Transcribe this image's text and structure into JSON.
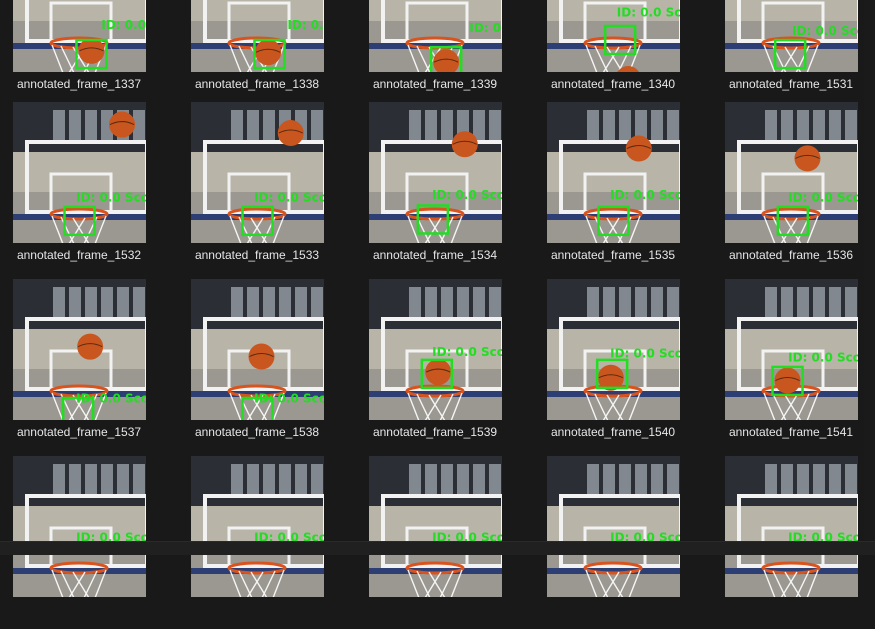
{
  "files": [
    {
      "name": "annotated_frame_1337",
      "ball": [
        0.59,
        0.85
      ],
      "det": [
        0.59,
        0.88
      ],
      "label": [
        0.74,
        0.64
      ],
      "rim": true
    },
    {
      "name": "annotated_frame_1338",
      "ball": [
        0.58,
        0.86
      ],
      "det": [
        0.59,
        0.88
      ],
      "label": [
        0.8,
        0.64
      ],
      "rim": true
    },
    {
      "name": "annotated_frame_1339",
      "ball": [
        0.58,
        0.93
      ],
      "det": [
        0.58,
        0.93
      ],
      "label": [
        0.83,
        0.66
      ],
      "rim": true
    },
    {
      "name": "annotated_frame_1340",
      "ball": [
        0.61,
        1.05
      ],
      "det": [
        0.55,
        0.78
      ],
      "label": [
        0.6,
        0.55
      ],
      "rim": true
    },
    {
      "name": "annotated_frame_1531",
      "ball": null,
      "det": [
        0.49,
        0.88
      ],
      "label": [
        0.58,
        0.68
      ],
      "rim": true
    },
    {
      "name": "annotated_frame_1532",
      "ball": [
        0.82,
        0.16
      ],
      "det": [
        0.5,
        0.85
      ],
      "label": [
        0.55,
        0.65
      ],
      "rim": true
    },
    {
      "name": "annotated_frame_1533",
      "ball": [
        0.75,
        0.22
      ],
      "det": [
        0.5,
        0.85
      ],
      "label": [
        0.55,
        0.65
      ],
      "rim": true
    },
    {
      "name": "annotated_frame_1534",
      "ball": [
        0.72,
        0.3
      ],
      "det": [
        0.48,
        0.84
      ],
      "label": [
        0.55,
        0.63
      ],
      "rim": true
    },
    {
      "name": "annotated_frame_1535",
      "ball": [
        0.69,
        0.33
      ],
      "det": [
        0.5,
        0.85
      ],
      "label": [
        0.55,
        0.63
      ],
      "rim": true
    },
    {
      "name": "annotated_frame_1536",
      "ball": [
        0.62,
        0.4
      ],
      "det": [
        0.51,
        0.85
      ],
      "label": [
        0.55,
        0.65
      ],
      "rim": true
    },
    {
      "name": "annotated_frame_1537",
      "ball": [
        0.58,
        0.48
      ],
      "det": [
        0.49,
        0.95
      ],
      "label": [
        0.55,
        0.82
      ],
      "rim": true
    },
    {
      "name": "annotated_frame_1538",
      "ball": [
        0.53,
        0.55
      ],
      "det": [
        0.5,
        0.95
      ],
      "label": [
        0.55,
        0.82
      ],
      "rim": true
    },
    {
      "name": "annotated_frame_1539",
      "ball": [
        0.52,
        0.66
      ],
      "det": [
        0.51,
        0.68
      ],
      "label": [
        0.55,
        0.49
      ],
      "rim": true
    },
    {
      "name": "annotated_frame_1540",
      "ball": [
        0.48,
        0.7
      ],
      "det": [
        0.49,
        0.68
      ],
      "label": [
        0.55,
        0.5
      ],
      "rim": true
    },
    {
      "name": "annotated_frame_1541",
      "ball": [
        0.47,
        0.72
      ],
      "det": [
        0.47,
        0.73
      ],
      "label": [
        0.55,
        0.53
      ],
      "rim": true
    },
    {
      "name": "",
      "ball": null,
      "det": null,
      "label": [
        0.55,
        0.55
      ],
      "rim": true
    },
    {
      "name": "",
      "ball": null,
      "det": null,
      "label": [
        0.55,
        0.55
      ],
      "rim": true
    },
    {
      "name": "",
      "ball": null,
      "det": null,
      "label": [
        0.55,
        0.55
      ],
      "rim": true
    },
    {
      "name": "",
      "ball": null,
      "det": null,
      "label": [
        0.55,
        0.55
      ],
      "rim": true
    },
    {
      "name": "",
      "ball": null,
      "det": null,
      "label": [
        0.55,
        0.55
      ],
      "rim": true
    }
  ],
  "overlay_text": "ID: 0.0 Sco",
  "colors": {
    "detection": "#22dd22",
    "ball": "#c8561e",
    "backboard": "#f2f2f2",
    "net": "#ffffff",
    "rim": "#d9531e"
  }
}
